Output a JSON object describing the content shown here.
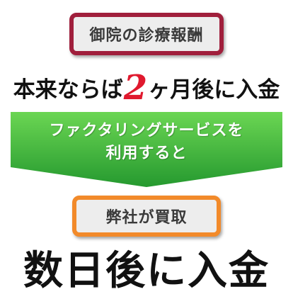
{
  "top_box": {
    "label": "御院の診療報酬"
  },
  "headline_1": {
    "before": "本来ならば",
    "accent": "2",
    "after": "ヶ月後に入金"
  },
  "arrow": {
    "line_1": "ファクタリングサービスを",
    "line_2": "利用すると"
  },
  "middle_box": {
    "label": "弊社が買取"
  },
  "headline_2": {
    "text": "数日後に入金"
  },
  "colors": {
    "top_box_border": "#a01f3c",
    "middle_box_border": "#f28a2a",
    "arrow_light": "#5fcf4a",
    "arrow_dark": "#2aa135",
    "accent": "#e0192e"
  }
}
